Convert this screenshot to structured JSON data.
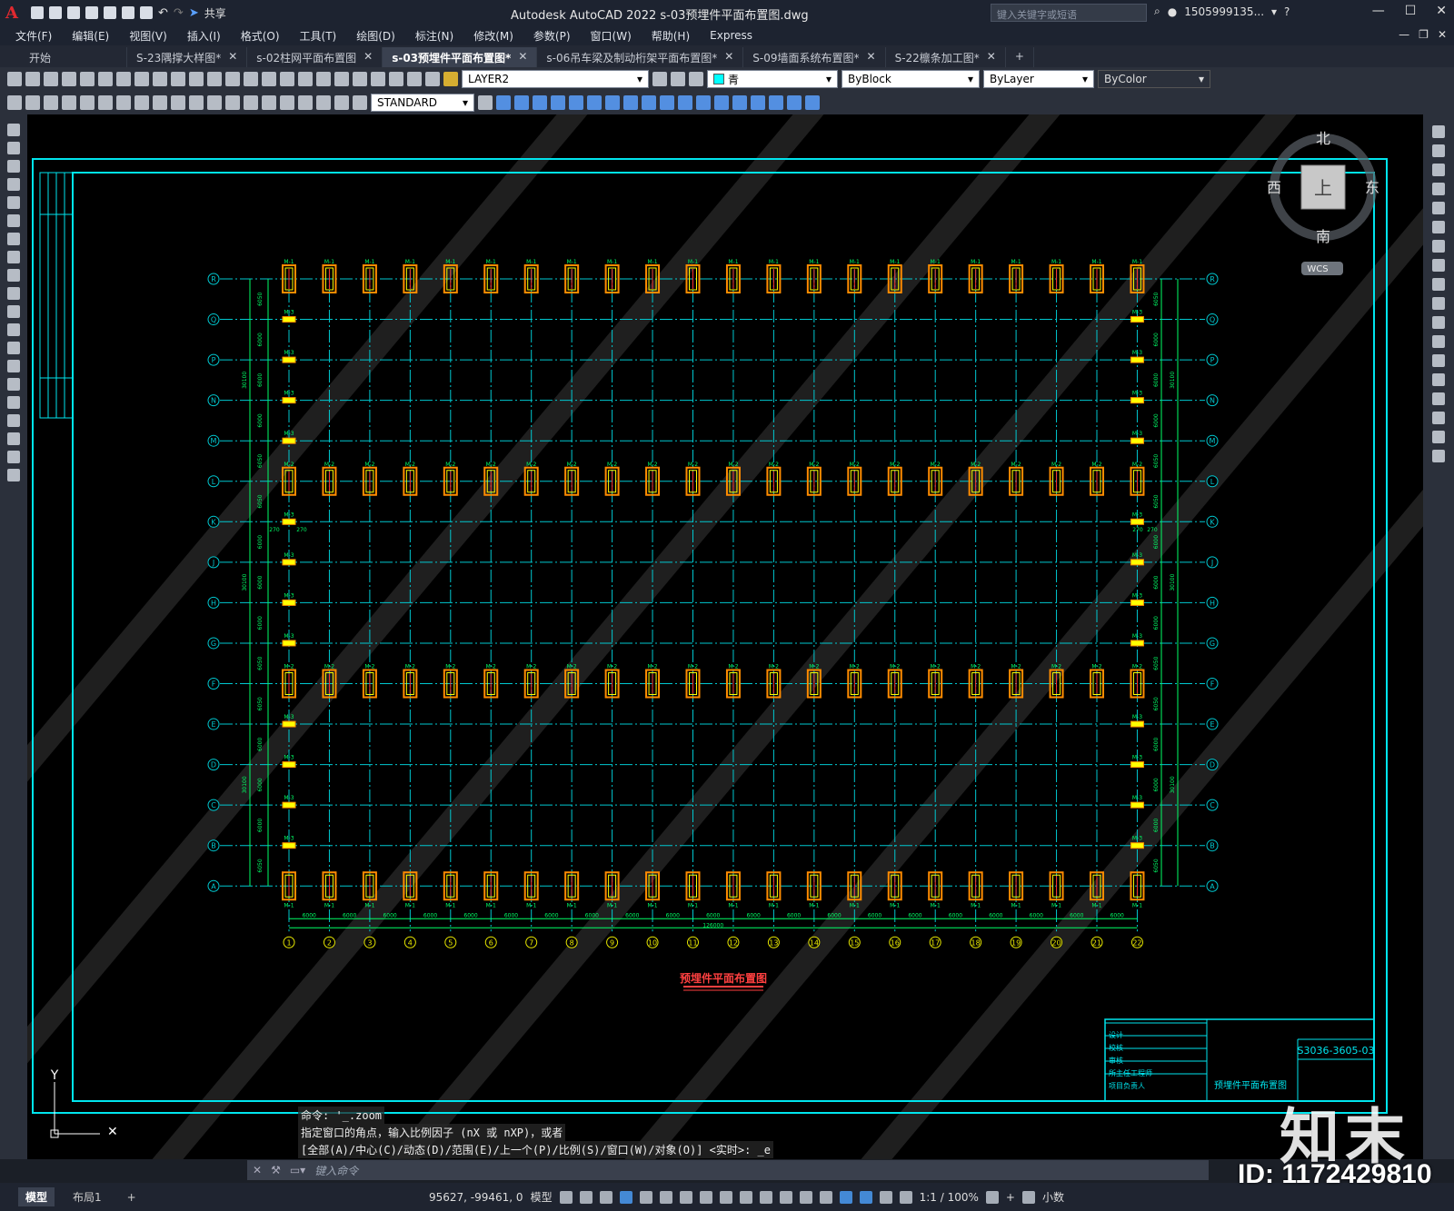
{
  "titlebar": {
    "app_logo": "A",
    "share": "共享",
    "title": "Autodesk AutoCAD 2022    s-03预埋件平面布置图.dwg",
    "search_placeholder": "键入关键字或短语",
    "user": "1505999135...",
    "help": "?"
  },
  "menu": [
    "文件(F)",
    "编辑(E)",
    "视图(V)",
    "插入(I)",
    "格式(O)",
    "工具(T)",
    "绘图(D)",
    "标注(N)",
    "修改(M)",
    "参数(P)",
    "窗口(W)",
    "帮助(H)",
    "Express"
  ],
  "tabs": [
    {
      "label": "开始",
      "closable": false
    },
    {
      "label": "S-23隅撑大样图*",
      "closable": true
    },
    {
      "label": "s-02柱网平面布置图",
      "closable": true
    },
    {
      "label": "s-03预埋件平面布置图*",
      "closable": true,
      "active": true
    },
    {
      "label": "s-06吊车梁及制动桁架平面布置图*",
      "closable": true
    },
    {
      "label": "S-09墙面系统布置图*",
      "closable": true
    },
    {
      "label": "S-22檩条加工图*",
      "closable": true
    }
  ],
  "toolbar": {
    "layer": "LAYER2",
    "color": "青",
    "linetype": "ByBlock",
    "lineweight": "ByLayer",
    "plotstyle": "ByColor",
    "textstyle": "STANDARD"
  },
  "viewcube": {
    "north": "北",
    "south": "南",
    "east": "东",
    "west": "西",
    "top": "上",
    "wcs": "WCS"
  },
  "drawing": {
    "row_axes": [
      "R",
      "Q",
      "P",
      "N",
      "M",
      "L",
      "K",
      "J",
      "H",
      "G",
      "F",
      "E",
      "D",
      "C",
      "B",
      "A"
    ],
    "col_axes": [
      "1",
      "2",
      "3",
      "4",
      "5",
      "6",
      "7",
      "8",
      "9",
      "10",
      "11",
      "12",
      "13",
      "14",
      "15",
      "16",
      "17",
      "18",
      "19",
      "20",
      "21",
      "22"
    ],
    "embed_labels": {
      "m1": "M-1",
      "m2": "M-2",
      "m3": "M-3"
    },
    "bay_dim": "6000",
    "total_dim": "126000",
    "row_dims": [
      "6050",
      "6000",
      "6000",
      "6000",
      "6000",
      "6050"
    ],
    "group_dim": "30100",
    "edge_dim": "270",
    "plan_title": "预埋件平面布置图",
    "titleblock": {
      "drawing_no": "S3036-3605-03",
      "drawing_name": "预埋件平面布置图",
      "rows": [
        "设计",
        "校核",
        "审核",
        "所主任工程师",
        "项目负责人"
      ]
    },
    "ucs_y": "Y"
  },
  "command": {
    "history": [
      "命令: '_.zoom",
      "指定窗口的角点，输入比例因子 (nX 或 nXP)，或者",
      "[全部(A)/中心(C)/动态(D)/范围(E)/上一个(P)/比例(S)/窗口(W)/对象(O)] <实时>: _e"
    ],
    "placeholder": "键入命令"
  },
  "layout_tabs": [
    "模型",
    "布局1"
  ],
  "status": {
    "coords": "95627, -99461, 0",
    "space": "模型",
    "scale": "1:1 / 100%",
    "units": "小数"
  },
  "watermark": {
    "brand": "知末",
    "id": "ID: 1172429810"
  },
  "colors": {
    "frame": "#00e5ee",
    "grid": "#00c8d0",
    "embed": "#ff8c00",
    "dim": "#00ff66",
    "bg": "#000000"
  }
}
